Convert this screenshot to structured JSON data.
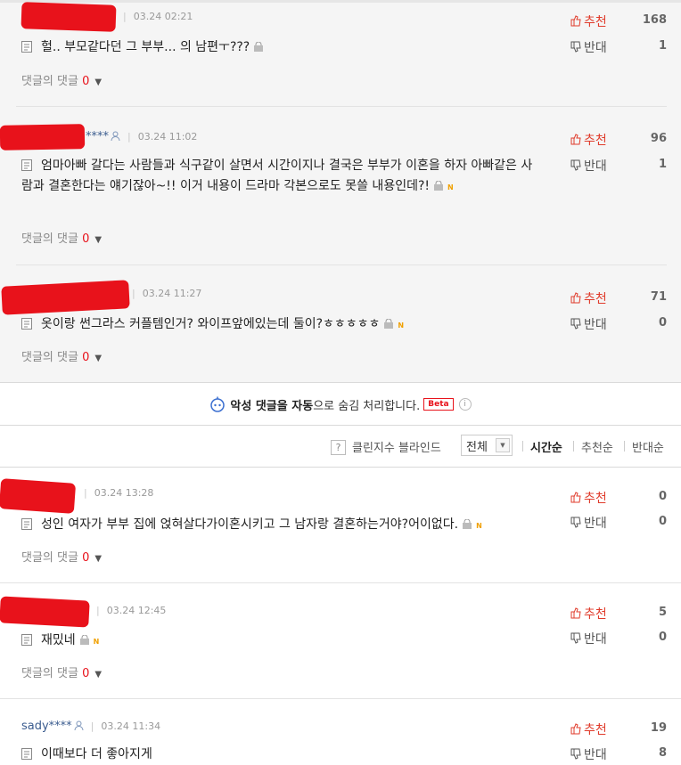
{
  "ui": {
    "reply_label": "댓글의 댓글",
    "up_label": "추천",
    "down_label": "반대",
    "new_badge": "N"
  },
  "comments": [
    {
      "username": "",
      "time": "03.24 02:21",
      "text": "헐.. 부모같다던 그 부부... 의 남편ㅜ???",
      "up": "168",
      "down": "1",
      "replies": "0"
    },
    {
      "username": "****",
      "time": "03.24 11:02",
      "text": "엄마아빠 갈다는 사람들과 식구같이 살면서 시간이지나 결국은 부부가 이혼을 하자 아빠같은 사람과 결혼한다는 얘기잖아~!! 이거 내용이 드라마 각본으로도 못쓸 내용인데?!",
      "up": "96",
      "down": "1",
      "replies": "0"
    },
    {
      "username": "",
      "time": "03.24 11:27",
      "text": "옷이랑 썬그라스 커플템인거? 와이프앞에있는데 둘이?ㅎㅎㅎㅎㅎ",
      "up": "71",
      "down": "0",
      "replies": "0"
    },
    {
      "username": "",
      "time": "03.24 13:28",
      "text": "성인 여자가 부부 집에 얹혀살다가이혼시키고 그 남자랑 결혼하는거야?어이없다.",
      "up": "0",
      "down": "0",
      "replies": "0"
    },
    {
      "username": "",
      "time": "03.24 12:45",
      "text": "재밌네",
      "up": "5",
      "down": "0",
      "replies": "0"
    },
    {
      "username": "sady****",
      "time": "03.24 11:34",
      "text": "이때보다 더 좋아지게",
      "up": "19",
      "down": "8",
      "replies": "0"
    }
  ],
  "notice": {
    "part1": "악성 댓글을 자동",
    "part2": "으로 숨김 처리합니다.",
    "beta": "Beta",
    "info": "i"
  },
  "sort_bar": {
    "help_icon": "?",
    "cleanbot_label": "클린지수 블라인드",
    "filter_value": "전체",
    "options": [
      "시간순",
      "추천순",
      "반대순"
    ],
    "active": "시간순"
  },
  "colors": {
    "accent_red": "#e8121b",
    "username_blue": "#3b5c8f",
    "bg_gray": "#f5f5f5"
  }
}
